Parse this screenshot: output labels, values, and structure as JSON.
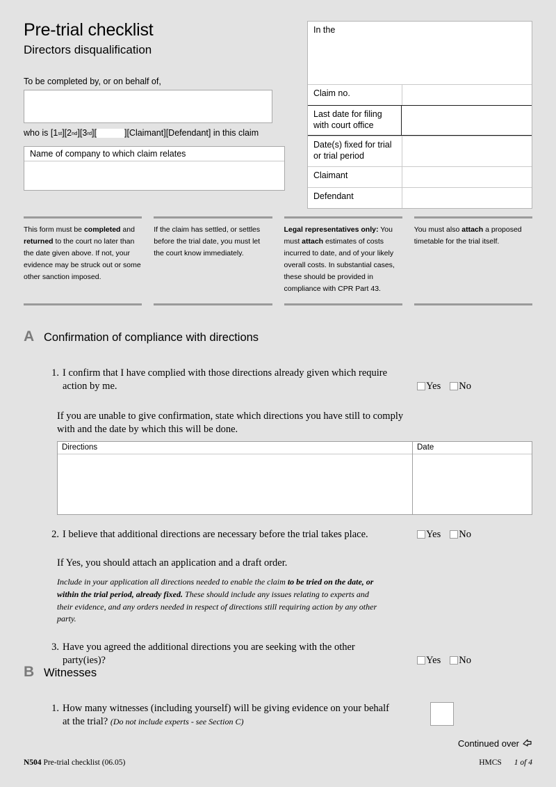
{
  "header": {
    "title": "Pre-trial checklist",
    "subtitle": "Directors disqualification",
    "to_be_completed_label": "To be completed by, or on behalf of,",
    "name_value": "",
    "who_is_prefix": "who is [1",
    "sup1": "st",
    "who_is_mid1": "][2",
    "sup2": "nd",
    "who_is_mid2": "][3",
    "sup3": "rd",
    "who_is_mid3": "][",
    "party_value": "",
    "who_is_suffix": "][Claimant][Defendant] in this claim",
    "company_label": "Name of company to which claim relates",
    "company_value": ""
  },
  "court": {
    "in_the_label": "In the",
    "in_the_value": "",
    "rows": [
      {
        "label": "Claim no.",
        "value": ""
      },
      {
        "label": "Last date for filing with court office",
        "value": "",
        "emphasis": true
      },
      {
        "label": "Date(s) fixed for trial or trial period",
        "value": ""
      },
      {
        "label": "Claimant",
        "value": ""
      },
      {
        "label": "Defendant",
        "value": ""
      }
    ]
  },
  "notes": [
    {
      "parts": [
        {
          "t": "This form must be ",
          "b": false
        },
        {
          "t": "completed",
          "b": true
        },
        {
          "t": " and ",
          "b": false
        },
        {
          "t": "returned",
          "b": true
        },
        {
          "t": " to the court no later than the date given above. If not, your evidence may be struck out or some other sanction imposed.",
          "b": false
        }
      ]
    },
    {
      "parts": [
        {
          "t": "If the claim has settled, or settles before the trial date, you must let the court know immediately.",
          "b": false
        }
      ]
    },
    {
      "parts": [
        {
          "t": "Legal representatives only:",
          "b": true
        },
        {
          "t": " You must ",
          "b": false
        },
        {
          "t": "attach",
          "b": true
        },
        {
          "t": " estimates of costs incurred to date, and of your likely overall costs. In substantial cases, these should be provided in compliance with CPR Part 43.",
          "b": false
        }
      ]
    },
    {
      "parts": [
        {
          "t": "You must also ",
          "b": false
        },
        {
          "t": "attach",
          "b": true
        },
        {
          "t": " a proposed timetable for the trial itself.",
          "b": false
        }
      ]
    }
  ],
  "section_a": {
    "letter": "A",
    "title": "Confirmation of compliance with directions",
    "q1": {
      "num": "1.",
      "text": "I confirm that I have complied with those directions already given which require action by me.",
      "yes": "Yes",
      "no": "No"
    },
    "q1_followup": "If you are unable to give confirmation, state which directions you have still to comply with and the date by which this will be done.",
    "directions_table": {
      "col_directions": "Directions",
      "col_date": "Date",
      "directions_value": "",
      "date_value": ""
    },
    "q2": {
      "num": "2.",
      "text": "I believe that additional directions are necessary before the trial takes place.",
      "yes": "Yes",
      "no": "No"
    },
    "q2_attach": "If Yes, you should attach an application and a draft order.",
    "q2_note_parts": [
      {
        "t": "Include in your application all directions needed to enable the claim ",
        "b": false
      },
      {
        "t": "to be tried on the date, or within the trial period, already fixed.",
        "b": true
      },
      {
        "t": " These should include any issues relating to experts and their evidence, and any orders needed in respect of directions still requiring action by any other party.",
        "b": false
      }
    ],
    "q3": {
      "num": "3.",
      "text": "Have you agreed the additional directions you are seeking with the other party(ies)?",
      "yes": "Yes",
      "no": "No"
    }
  },
  "section_b": {
    "letter": "B",
    "title": "Witnesses",
    "q1": {
      "num": "1.",
      "text": "How many witnesses (including yourself) will be giving evidence on your behalf at the trial? ",
      "note": "(Do not include experts - see Section C)",
      "count_value": ""
    }
  },
  "footer": {
    "continued": "Continued over",
    "continued_icon": "↪",
    "form_code": "N504",
    "form_name": "Pre-trial checklist (06.05)",
    "agency": "HMCS",
    "page": "1 of 4"
  },
  "colors": {
    "background": "#e3e3e3",
    "rule": "#9a9a9a",
    "section_letter": "#7a7a7a",
    "box_border": "#a8a8a8",
    "emphasis_border": "#1a1a1a"
  }
}
